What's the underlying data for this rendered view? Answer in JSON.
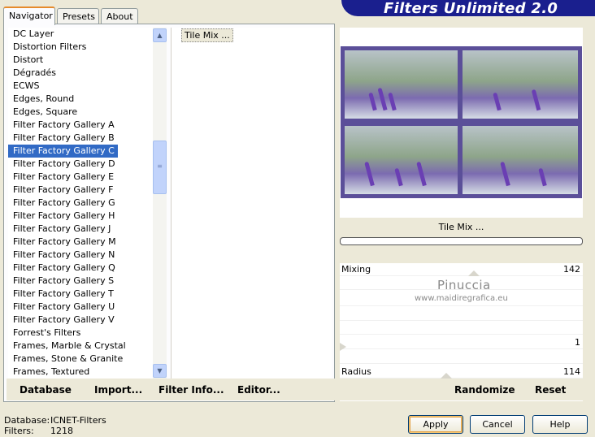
{
  "tabs": [
    "Navigator",
    "Presets",
    "About"
  ],
  "title": "Filters Unlimited 2.0",
  "categories": [
    "DC Layer",
    "Distortion Filters",
    "Distort",
    "Dégradés",
    "ECWS",
    "Edges, Round",
    "Edges, Square",
    "Filter Factory Gallery A",
    "Filter Factory Gallery B",
    "Filter Factory Gallery C",
    "Filter Factory Gallery D",
    "Filter Factory Gallery E",
    "Filter Factory Gallery F",
    "Filter Factory Gallery G",
    "Filter Factory Gallery H",
    "Filter Factory Gallery J",
    "Filter Factory Gallery M",
    "Filter Factory Gallery N",
    "Filter Factory Gallery Q",
    "Filter Factory Gallery S",
    "Filter Factory Gallery T",
    "Filter Factory Gallery U",
    "Filter Factory Gallery V",
    "Forrest's Filters",
    "Frames, Marble & Crystal",
    "Frames, Stone & Granite",
    "Frames, Textured"
  ],
  "selected_category": "Filter Factory Gallery C",
  "filters": [
    "Tile Mix ..."
  ],
  "left_buttons": {
    "database": "Database",
    "import": "Import...",
    "filter_info": "Filter Info...",
    "editor": "Editor..."
  },
  "preview_label": "Tile Mix ...",
  "params": {
    "mixing_label": "Mixing",
    "mixing_value": "142",
    "third_value": "1",
    "radius_label": "Radius",
    "radius_value": "114"
  },
  "watermark": {
    "line1": "Pinuccia",
    "line2": "www.maidiregrafica.eu"
  },
  "right_buttons": {
    "randomize": "Randomize",
    "reset": "Reset"
  },
  "status": {
    "database_label": "Database:",
    "database_value": "ICNET-Filters",
    "filters_label": "Filters:",
    "filters_value": "1218"
  },
  "dialog_buttons": {
    "apply": "Apply",
    "cancel": "Cancel",
    "help": "Help"
  },
  "colors": {
    "banner": "#1a1f8e",
    "selection": "#316ac5",
    "preview_border": "#5b4f99",
    "tab_accent": "#e68b2c"
  }
}
